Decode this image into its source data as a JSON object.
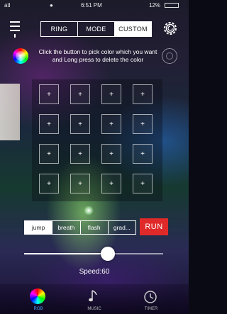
{
  "status": {
    "time": "6:51 PM",
    "battery": "12%",
    "carrier": "atl"
  },
  "nav": {
    "segments": [
      {
        "label": "RING",
        "active": false
      },
      {
        "label": "MODE",
        "active": false
      },
      {
        "label": "CUSTOM",
        "active": true
      }
    ]
  },
  "instructions": "Click the button to pick color which you want and Long press to delete the color",
  "grid": {
    "cell_symbol": "+",
    "rows": 4,
    "cols": 4
  },
  "effects": {
    "options": [
      {
        "label": "jump",
        "active": true
      },
      {
        "label": "breath",
        "active": false
      },
      {
        "label": "flash",
        "active": false
      },
      {
        "label": "grad...",
        "active": false
      }
    ],
    "run_label": "RUN"
  },
  "speed": {
    "label": "Speed:60",
    "value": 60,
    "max": 100
  },
  "tabbar": {
    "tabs": [
      {
        "label": "RGB",
        "icon": "color-wheel-icon",
        "active": true
      },
      {
        "label": "MUSIC",
        "icon": "music-note-icon",
        "active": false
      },
      {
        "label": "TIMER",
        "icon": "timer-icon",
        "active": false
      }
    ]
  },
  "colors": {
    "accent": "#e02a2a",
    "active_tab": "#4ea8ff"
  }
}
